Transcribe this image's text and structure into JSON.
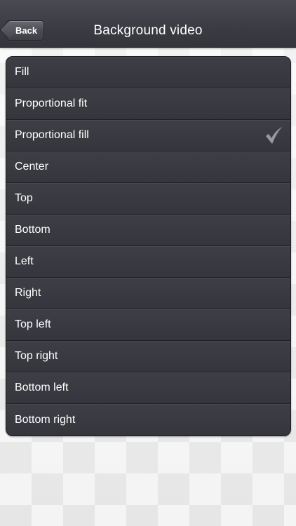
{
  "navbar": {
    "back_label": "Back",
    "title": "Background video"
  },
  "options": [
    {
      "label": "Fill",
      "selected": false
    },
    {
      "label": "Proportional fit",
      "selected": false
    },
    {
      "label": "Proportional fill",
      "selected": true
    },
    {
      "label": "Center",
      "selected": false
    },
    {
      "label": "Top",
      "selected": false
    },
    {
      "label": "Bottom",
      "selected": false
    },
    {
      "label": "Left",
      "selected": false
    },
    {
      "label": "Right",
      "selected": false
    },
    {
      "label": "Top left",
      "selected": false
    },
    {
      "label": "Top right",
      "selected": false
    },
    {
      "label": "Bottom left",
      "selected": false
    },
    {
      "label": "Bottom right",
      "selected": false
    }
  ],
  "icons": {
    "selected_marker": "checkmark-icon"
  },
  "colors": {
    "navbar": "#3c3d44",
    "row": "#38393f",
    "text": "#ffffff",
    "checkmark": "#9a9ba0",
    "background": "#ececec"
  }
}
